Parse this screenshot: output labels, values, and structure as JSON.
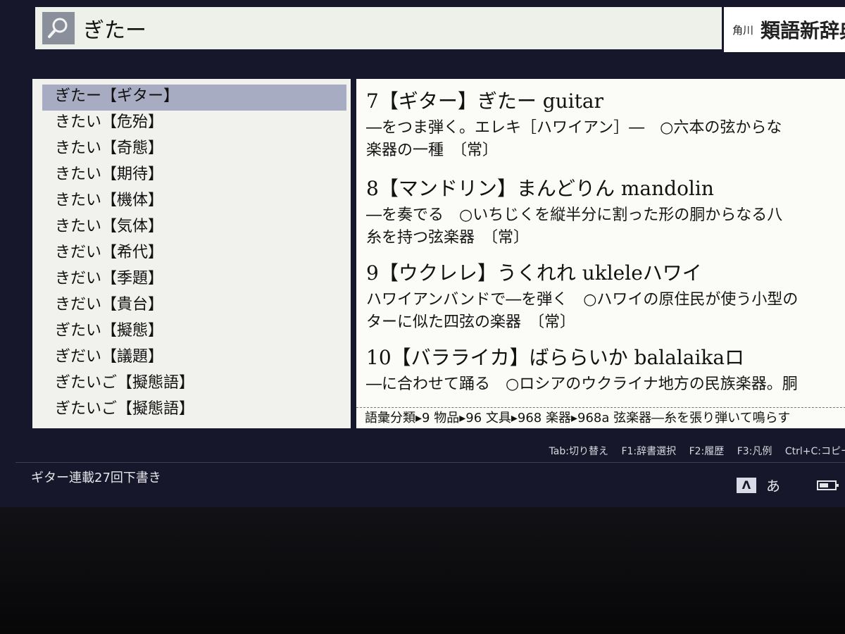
{
  "search": {
    "query": "ぎたー",
    "icon": "search-icon"
  },
  "dictionary": {
    "publisher": "角川",
    "name": "類語新辞典"
  },
  "word_list": [
    {
      "label": "ぎたー【ギター】",
      "selected": true
    },
    {
      "label": "きたい【危殆】",
      "selected": false
    },
    {
      "label": "きたい【奇態】",
      "selected": false
    },
    {
      "label": "きたい【期待】",
      "selected": false
    },
    {
      "label": "きたい【機体】",
      "selected": false
    },
    {
      "label": "きたい【気体】",
      "selected": false
    },
    {
      "label": "きだい【希代】",
      "selected": false
    },
    {
      "label": "きだい【季題】",
      "selected": false
    },
    {
      "label": "きだい【貴台】",
      "selected": false
    },
    {
      "label": "ぎたい【擬態】",
      "selected": false
    },
    {
      "label": "ぎだい【議題】",
      "selected": false
    },
    {
      "label": "ぎたいご【擬態語】",
      "selected": false
    },
    {
      "label": "ぎたいご【擬態語】",
      "selected": false
    }
  ],
  "entries": [
    {
      "head": "7【ギター】ぎたー guitar",
      "line1": "―をつま弾く。エレキ［ハワイアン］―　○六本の弦からな",
      "line2": "楽器の一種　〔常〕"
    },
    {
      "head": "8【マンドリン】まんどりん mandolin",
      "line1": "―を奏でる　○いちじくを縦半分に割った形の胴からなる八",
      "line2": "糸を持つ弦楽器　〔常〕"
    },
    {
      "head": "9【ウクレレ】うくれれ ukleleハワイ",
      "line1": "ハワイアンバンドで―を弾く　○ハワイの原住民が使う小型の",
      "line2": "ターに似た四弦の楽器　〔常〕"
    },
    {
      "head": "10【バラライカ】ばららいか balalaikaロ",
      "line1": "―に合わせて踊る　○ロシアのウクライナ地方の民族楽器。胴",
      "line2": ""
    }
  ],
  "category_path": "語彙分類▸9 物品▸96 文具▸968 楽器▸968a 弦楽器―糸を張り弾いて鳴らす",
  "key_hints": {
    "tab": "Tab:切り替え",
    "f1": "F1:辞書選択",
    "f2": "F2:履歴",
    "f3": "F3:凡例",
    "ctrl_c": "Ctrl+C:コピー"
  },
  "status": {
    "text": "ギター連載27回下書き",
    "ime_indicator": "Λ",
    "ime_mode": "あ",
    "battery_icon": "battery-icon"
  }
}
